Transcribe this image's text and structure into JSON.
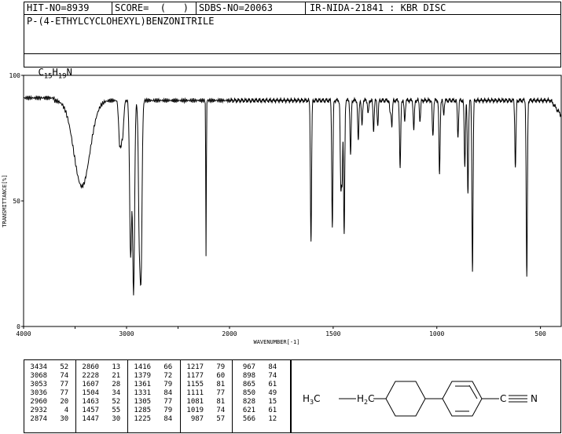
{
  "header": {
    "hit": "HIT-NO=8939",
    "score": "SCORE=  (   )",
    "sdbs": "SDBS-NO=20063",
    "method": "IR-NIDA-21841 : KBR DISC",
    "compound": "P-(4-ETHYLCYCLOHEXYL)BENZONITRILE",
    "formula_prefix": "C",
    "formula_c": "15",
    "formula_h_prefix": "H",
    "formula_h": "19",
    "formula_suffix": "N"
  },
  "chart_data": {
    "type": "line",
    "xlabel": "WAVENUMBER[-1]",
    "ylabel": "TRANSMITTANCE[%]",
    "xlim": [
      4000,
      400
    ],
    "ylim": [
      0,
      100
    ],
    "xticks": [
      "4000",
      "3000",
      "2000",
      "1500",
      "1000",
      "500"
    ],
    "yticks": [
      "100",
      "50",
      "0"
    ],
    "baseline": 90,
    "peaks": [
      {
        "x": 3434,
        "y": 52
      },
      {
        "x": 3068,
        "y": 74
      },
      {
        "x": 3053,
        "y": 77
      },
      {
        "x": 3036,
        "y": 77
      },
      {
        "x": 2960,
        "y": 20
      },
      {
        "x": 2932,
        "y": 4
      },
      {
        "x": 2874,
        "y": 30
      },
      {
        "x": 2860,
        "y": 13
      },
      {
        "x": 2228,
        "y": 21
      },
      {
        "x": 1607,
        "y": 28
      },
      {
        "x": 1504,
        "y": 34
      },
      {
        "x": 1463,
        "y": 52
      },
      {
        "x": 1457,
        "y": 55
      },
      {
        "x": 1447,
        "y": 30
      },
      {
        "x": 1416,
        "y": 66
      },
      {
        "x": 1379,
        "y": 72
      },
      {
        "x": 1361,
        "y": 79
      },
      {
        "x": 1331,
        "y": 84
      },
      {
        "x": 1305,
        "y": 77
      },
      {
        "x": 1285,
        "y": 79
      },
      {
        "x": 1225,
        "y": 84
      },
      {
        "x": 1217,
        "y": 79
      },
      {
        "x": 1177,
        "y": 60
      },
      {
        "x": 1155,
        "y": 81
      },
      {
        "x": 1111,
        "y": 77
      },
      {
        "x": 1081,
        "y": 81
      },
      {
        "x": 1019,
        "y": 74
      },
      {
        "x": 987,
        "y": 57
      },
      {
        "x": 967,
        "y": 84
      },
      {
        "x": 898,
        "y": 74
      },
      {
        "x": 865,
        "y": 61
      },
      {
        "x": 850,
        "y": 49
      },
      {
        "x": 828,
        "y": 15
      },
      {
        "x": 621,
        "y": 61
      },
      {
        "x": 566,
        "y": 12
      }
    ]
  },
  "peak_table": [
    [
      [
        "3434",
        "52"
      ],
      [
        "3068",
        "74"
      ],
      [
        "3053",
        "77"
      ],
      [
        "3036",
        "77"
      ],
      [
        "2960",
        "20"
      ],
      [
        "2932",
        "4"
      ],
      [
        "2874",
        "30"
      ]
    ],
    [
      [
        "2860",
        "13"
      ],
      [
        "2228",
        "21"
      ],
      [
        "1607",
        "28"
      ],
      [
        "1504",
        "34"
      ],
      [
        "1463",
        "52"
      ],
      [
        "1457",
        "55"
      ],
      [
        "1447",
        "30"
      ]
    ],
    [
      [
        "1416",
        "66"
      ],
      [
        "1379",
        "72"
      ],
      [
        "1361",
        "79"
      ],
      [
        "1331",
        "84"
      ],
      [
        "1305",
        "77"
      ],
      [
        "1285",
        "79"
      ],
      [
        "1225",
        "84"
      ]
    ],
    [
      [
        "1217",
        "79"
      ],
      [
        "1177",
        "60"
      ],
      [
        "1155",
        "81"
      ],
      [
        "1111",
        "77"
      ],
      [
        "1081",
        "81"
      ],
      [
        "1019",
        "74"
      ],
      [
        "987",
        "57"
      ]
    ],
    [
      [
        "967",
        "84"
      ],
      [
        "898",
        "74"
      ],
      [
        "865",
        "61"
      ],
      [
        "850",
        "49"
      ],
      [
        "828",
        "15"
      ],
      [
        "621",
        "61"
      ],
      [
        "566",
        "12"
      ]
    ]
  ],
  "structure": {
    "left_label": "H",
    "left_sub": "3",
    "left_c": "C",
    "mid_label": "H",
    "mid_sub": "2",
    "mid_c": "C",
    "right_label": "C",
    "right_n": "N"
  }
}
